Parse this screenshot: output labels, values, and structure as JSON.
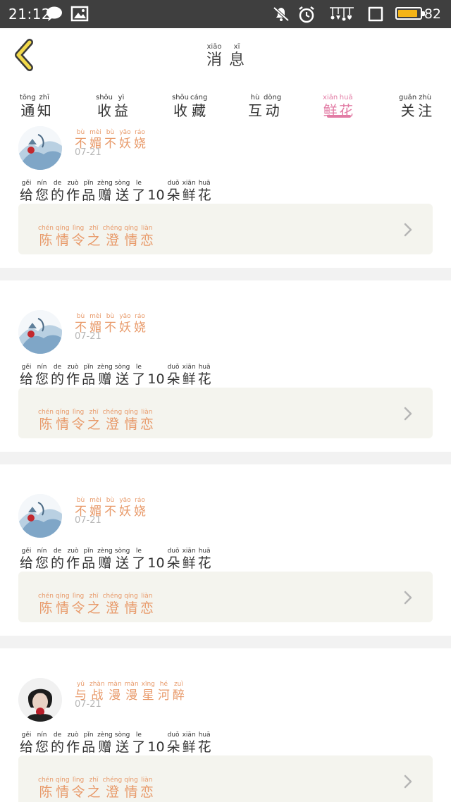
{
  "status_bar": {
    "time": "21:12",
    "battery_percent": "82",
    "icons": [
      "chat-bubble-icon",
      "image-icon",
      "mute-icon",
      "alarm-icon",
      "signal-icon",
      "screen-icon",
      "battery-icon"
    ]
  },
  "header": {
    "title": [
      {
        "hz": "消",
        "py": "xiāo"
      },
      {
        "hz": "息",
        "py": "xī"
      }
    ]
  },
  "tabs": [
    {
      "chars": [
        {
          "hz": "通",
          "py": "tōng"
        },
        {
          "hz": "知",
          "py": "zhī"
        }
      ]
    },
    {
      "chars": [
        {
          "hz": "收",
          "py": "shōu"
        },
        {
          "hz": "益",
          "py": "yì"
        }
      ]
    },
    {
      "chars": [
        {
          "hz": "收",
          "py": "shōu"
        },
        {
          "hz": "藏",
          "py": "cáng"
        }
      ]
    },
    {
      "chars": [
        {
          "hz": "互",
          "py": "hù"
        },
        {
          "hz": "动",
          "py": "dòng"
        }
      ]
    },
    {
      "chars": [
        {
          "hz": "鲜",
          "py": "xiān"
        },
        {
          "hz": "花",
          "py": "huā"
        }
      ]
    },
    {
      "chars": [
        {
          "hz": "关",
          "py": "guān"
        },
        {
          "hz": "注",
          "py": "zhù"
        }
      ]
    }
  ],
  "active_tab_index": 4,
  "colors": {
    "accent": "#e27ba4",
    "username": "#e89a6a",
    "work_box_bg": "#f4f4ee",
    "status_bar_bg": "#3f3f3f",
    "battery_fill": "#f4b417"
  },
  "message_text": [
    {
      "hz": "给",
      "py": "gěi"
    },
    {
      "hz": "您",
      "py": "nín"
    },
    {
      "hz": "的",
      "py": "de"
    },
    {
      "hz": "作",
      "py": "zuò"
    },
    {
      "hz": "品",
      "py": "pǐn"
    },
    {
      "hz": "赠",
      "py": "zèng"
    },
    {
      "hz": "送",
      "py": "sòng"
    },
    {
      "hz": "了",
      "py": "le"
    },
    {
      "hz": "10",
      "py": ""
    },
    {
      "hz": "朵",
      "py": "duǒ"
    },
    {
      "hz": "鲜",
      "py": "xiān"
    },
    {
      "hz": "花",
      "py": "huā"
    }
  ],
  "notifications": [
    {
      "username": [
        {
          "hz": "不",
          "py": "bù"
        },
        {
          "hz": "媚",
          "py": "mèi"
        },
        {
          "hz": "不",
          "py": "bù"
        },
        {
          "hz": "妖",
          "py": "yāo"
        },
        {
          "hz": "娆",
          "py": "ráo"
        }
      ],
      "date": "07-21",
      "avatar": "landscape-avatar",
      "work_title": [
        {
          "hz": "陈",
          "py": "chén"
        },
        {
          "hz": "情",
          "py": "qíng"
        },
        {
          "hz": "令",
          "py": "lìng"
        },
        {
          "hz": "之",
          "py": "zhī"
        },
        {
          "hz": "澄",
          "py": "chéng"
        },
        {
          "hz": "情",
          "py": "qíng"
        },
        {
          "hz": "恋",
          "py": "liàn"
        }
      ]
    },
    {
      "username": [
        {
          "hz": "不",
          "py": "bù"
        },
        {
          "hz": "媚",
          "py": "mèi"
        },
        {
          "hz": "不",
          "py": "bù"
        },
        {
          "hz": "妖",
          "py": "yāo"
        },
        {
          "hz": "娆",
          "py": "ráo"
        }
      ],
      "date": "07-21",
      "avatar": "landscape-avatar",
      "work_title": [
        {
          "hz": "陈",
          "py": "chén"
        },
        {
          "hz": "情",
          "py": "qíng"
        },
        {
          "hz": "令",
          "py": "lìng"
        },
        {
          "hz": "之",
          "py": "zhī"
        },
        {
          "hz": "澄",
          "py": "chéng"
        },
        {
          "hz": "情",
          "py": "qíng"
        },
        {
          "hz": "恋",
          "py": "liàn"
        }
      ]
    },
    {
      "username": [
        {
          "hz": "不",
          "py": "bù"
        },
        {
          "hz": "媚",
          "py": "mèi"
        },
        {
          "hz": "不",
          "py": "bù"
        },
        {
          "hz": "妖",
          "py": "yāo"
        },
        {
          "hz": "娆",
          "py": "ráo"
        }
      ],
      "date": "07-21",
      "avatar": "landscape-avatar",
      "work_title": [
        {
          "hz": "陈",
          "py": "chén"
        },
        {
          "hz": "情",
          "py": "qíng"
        },
        {
          "hz": "令",
          "py": "lìng"
        },
        {
          "hz": "之",
          "py": "zhī"
        },
        {
          "hz": "澄",
          "py": "chéng"
        },
        {
          "hz": "情",
          "py": "qíng"
        },
        {
          "hz": "恋",
          "py": "liàn"
        }
      ]
    },
    {
      "username": [
        {
          "hz": "与",
          "py": "yǔ"
        },
        {
          "hz": "战",
          "py": "zhàn"
        },
        {
          "hz": "漫",
          "py": "màn"
        },
        {
          "hz": "漫",
          "py": "màn"
        },
        {
          "hz": "星",
          "py": "xīng"
        },
        {
          "hz": "河",
          "py": "hé"
        },
        {
          "hz": "醉",
          "py": "zuì"
        }
      ],
      "date": "07-21",
      "avatar": "portrait-avatar",
      "work_title": [
        {
          "hz": "陈",
          "py": "chén"
        },
        {
          "hz": "情",
          "py": "qíng"
        },
        {
          "hz": "令",
          "py": "lìng"
        },
        {
          "hz": "之",
          "py": "zhī"
        },
        {
          "hz": "澄",
          "py": "chéng"
        },
        {
          "hz": "情",
          "py": "qíng"
        },
        {
          "hz": "恋",
          "py": "liàn"
        }
      ]
    }
  ]
}
